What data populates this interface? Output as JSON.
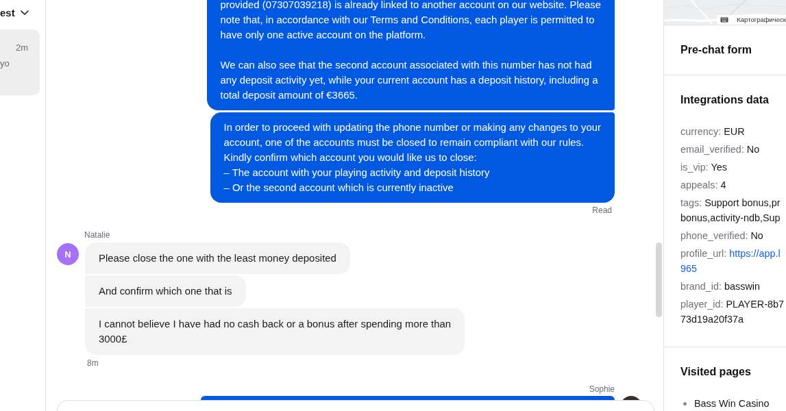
{
  "conversation_list": {
    "sort_label": "est",
    "conversations": [
      {
        "time": "2m",
        "preview": "yo",
        "selected": true
      }
    ]
  },
  "chat": {
    "groups": [
      {
        "kind": "agent",
        "bubbles": [
          "provided (07307039218) is already linked to another account on our website. Please\nnote that, in accordance with our Terms and Conditions, each player is permitted to\nhave only one active account on the platform.\n\nWe can also see that the second account associated with this number has not had\nany deposit activity yet, while your current account has a deposit history, including a\ntotal deposit amount of €3665.",
          "In order to proceed with updating the phone number or making any changes to your\naccount, one of the accounts must be closed to remain compliant with our rules.\nKindly confirm which account you would like us to close:\n– The account with your playing activity and deposit history\n– Or the second account which is currently inactive"
        ],
        "status": "Read"
      },
      {
        "kind": "visitor",
        "sender": "Natalie",
        "initial": "N",
        "bubbles": [
          "Please close the one with the least money deposited",
          "And confirm which one that is",
          "I cannot believe I have had no cash back or a bonus after spending more than\n3000£"
        ],
        "time": "8m"
      },
      {
        "kind": "agent",
        "sender": "Sophie"
      }
    ]
  },
  "details": {
    "map": {
      "attribution": "Картографическ"
    },
    "sections": [
      {
        "title": "Pre-chat form"
      },
      {
        "title": "Integrations data",
        "fields": [
          {
            "key": "currency:",
            "value_lines": [
              "EUR"
            ],
            "kind": "text"
          },
          {
            "key": "email_verified:",
            "value_lines": [
              "No"
            ],
            "kind": "text"
          },
          {
            "key": "is_vip:",
            "value_lines": [
              "Yes"
            ],
            "kind": "text"
          },
          {
            "key": "appeals:",
            "value_lines": [
              "4"
            ],
            "kind": "text"
          },
          {
            "key": "tags:",
            "value_lines": [
              "Support bonus,pr",
              "bonus,activity-ndb,Sup"
            ],
            "kind": "text"
          },
          {
            "key": "phone_verified:",
            "value_lines": [
              "No"
            ],
            "kind": "text"
          },
          {
            "key": "profile_url:",
            "value_lines": [
              "https://app.l",
              "965"
            ],
            "kind": "link"
          },
          {
            "key": "brand_id:",
            "value_lines": [
              "basswin"
            ],
            "kind": "text"
          },
          {
            "key": "player_id:",
            "value_lines": [
              "PLAYER-8b7",
              "73d19a20f37a"
            ],
            "kind": "text"
          }
        ]
      },
      {
        "title": "Visited pages",
        "pages": [
          "Bass Win Casino"
        ]
      }
    ]
  }
}
